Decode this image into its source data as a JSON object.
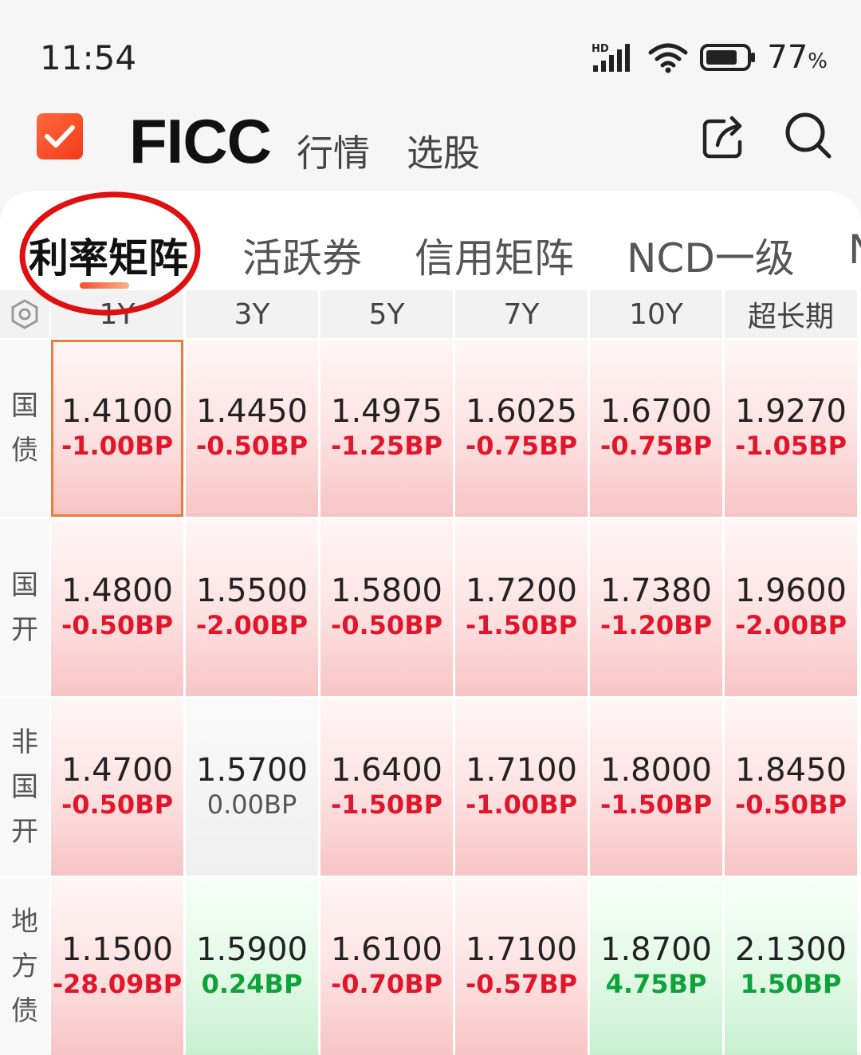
{
  "status_bar": {
    "time": "11:54",
    "network_label": "HD",
    "battery_percent": "77",
    "percent_sign": "%"
  },
  "header": {
    "title": "FICC",
    "nav": [
      "行情",
      "选股"
    ],
    "share_icon": "share-icon",
    "search_icon": "search-icon"
  },
  "tabs": [
    {
      "label": "利率矩阵",
      "active": true
    },
    {
      "label": "活跃券",
      "active": false
    },
    {
      "label": "信用矩阵",
      "active": false
    },
    {
      "label": "NCD一级",
      "active": false
    },
    {
      "label": "N",
      "active": false
    }
  ],
  "matrix": {
    "columns": [
      "1Y",
      "3Y",
      "5Y",
      "7Y",
      "10Y",
      "超长期"
    ],
    "rows": [
      {
        "label": [
          "国",
          "债"
        ],
        "cells": [
          {
            "value": "1.4100",
            "change": "-1.00BP",
            "trend": "down"
          },
          {
            "value": "1.4450",
            "change": "-0.50BP",
            "trend": "down"
          },
          {
            "value": "1.4975",
            "change": "-1.25BP",
            "trend": "down"
          },
          {
            "value": "1.6025",
            "change": "-0.75BP",
            "trend": "down"
          },
          {
            "value": "1.6700",
            "change": "-0.75BP",
            "trend": "down"
          },
          {
            "value": "1.9270",
            "change": "-1.05BP",
            "trend": "down"
          }
        ]
      },
      {
        "label": [
          "国",
          "开"
        ],
        "cells": [
          {
            "value": "1.4800",
            "change": "-0.50BP",
            "trend": "down"
          },
          {
            "value": "1.5500",
            "change": "-2.00BP",
            "trend": "down"
          },
          {
            "value": "1.5800",
            "change": "-0.50BP",
            "trend": "down"
          },
          {
            "value": "1.7200",
            "change": "-1.50BP",
            "trend": "down"
          },
          {
            "value": "1.7380",
            "change": "-1.20BP",
            "trend": "down"
          },
          {
            "value": "1.9600",
            "change": "-2.00BP",
            "trend": "down"
          }
        ]
      },
      {
        "label": [
          "非",
          "国",
          "开"
        ],
        "cells": [
          {
            "value": "1.4700",
            "change": "-0.50BP",
            "trend": "down"
          },
          {
            "value": "1.5700",
            "change": "0.00BP",
            "trend": "flat"
          },
          {
            "value": "1.6400",
            "change": "-1.50BP",
            "trend": "down"
          },
          {
            "value": "1.7100",
            "change": "-1.00BP",
            "trend": "down"
          },
          {
            "value": "1.8000",
            "change": "-1.50BP",
            "trend": "down"
          },
          {
            "value": "1.8450",
            "change": "-0.50BP",
            "trend": "down"
          }
        ]
      },
      {
        "label": [
          "地",
          "方",
          "债"
        ],
        "cells": [
          {
            "value": "1.1500",
            "change": "-28.09BP",
            "trend": "down"
          },
          {
            "value": "1.5900",
            "change": "0.24BP",
            "trend": "up"
          },
          {
            "value": "1.6100",
            "change": "-0.70BP",
            "trend": "down"
          },
          {
            "value": "1.7100",
            "change": "-0.57BP",
            "trend": "down"
          },
          {
            "value": "1.8700",
            "change": "4.75BP",
            "trend": "up"
          },
          {
            "value": "2.1300",
            "change": "1.50BP",
            "trend": "up"
          }
        ]
      }
    ]
  },
  "colors": {
    "down": "#e2162b",
    "up": "#0ea33a",
    "flat": "#555555",
    "accent": "#f54e2d",
    "annotation_circle": "#e01010"
  }
}
